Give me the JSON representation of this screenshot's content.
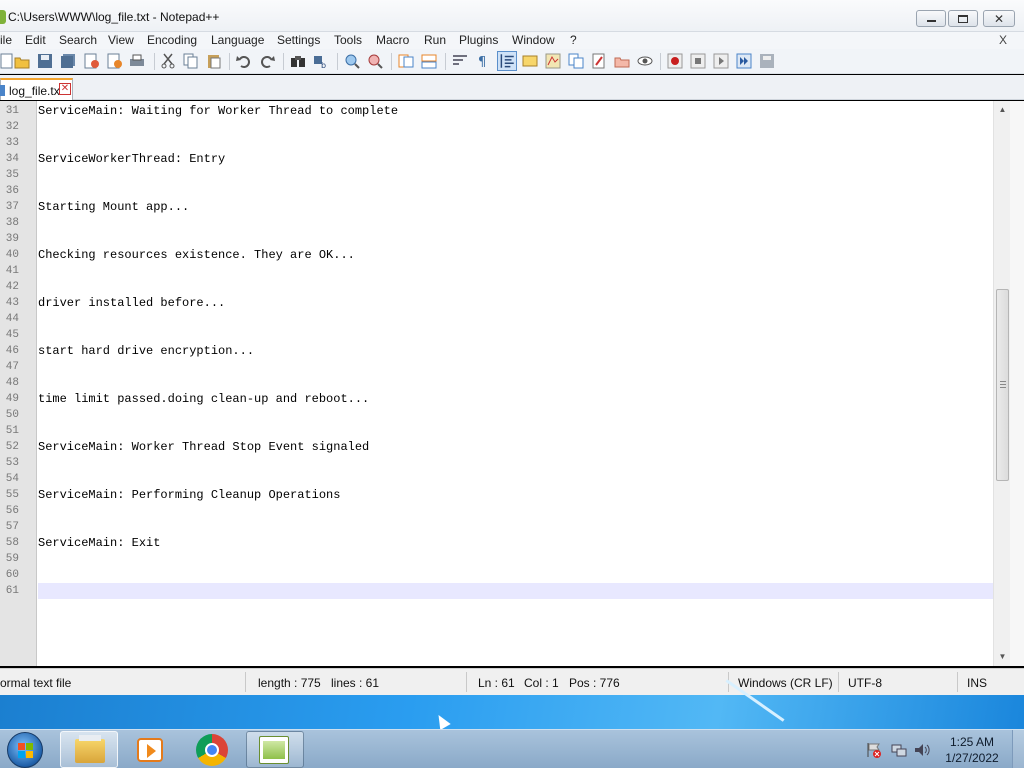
{
  "window": {
    "title": "C:\\Users\\WWW\\log_file.txt - Notepad++"
  },
  "menu": {
    "items": [
      "ile",
      "Edit",
      "Search",
      "View",
      "Encoding",
      "Language",
      "Settings",
      "Tools",
      "Macro",
      "Run",
      "Plugins",
      "Window",
      "?"
    ],
    "close_label": "X"
  },
  "toolbar": {
    "icons": [
      "new-file-icon",
      "open-file-icon",
      "save-icon",
      "save-all-icon",
      "close-icon",
      "close-all-icon",
      "print-icon",
      "cut-icon",
      "copy-icon",
      "paste-icon",
      "undo-icon",
      "redo-icon",
      "find-icon",
      "replace-icon",
      "zoom-in-icon",
      "zoom-out-icon",
      "sync-vertical-icon",
      "sync-horizontal-icon",
      "word-wrap-icon",
      "show-all-characters-icon",
      "indent-guide-icon",
      "user-language-icon",
      "document-map-icon",
      "function-list-icon",
      "folder-as-workspace-icon",
      "monitoring-icon",
      "record-macro-icon",
      "stop-recording-icon",
      "playback-macro-icon",
      "run-macro-multiple-icon",
      "save-macro-icon"
    ],
    "active_icon": "indent-guide-icon"
  },
  "tab": {
    "label": "log_file.txt",
    "close_glyph": "✕"
  },
  "editor": {
    "first_line_number": 31,
    "lines": [
      "ServiceMain: Waiting for Worker Thread to complete",
      "",
      "",
      "ServiceWorkerThread: Entry",
      "",
      "",
      "Starting Mount app...",
      "",
      "",
      "Checking resources existence. They are OK...",
      "",
      "",
      "driver installed before...",
      "",
      "",
      "start hard drive encryption...",
      "",
      "",
      "time limit passed.doing clean-up and reboot...",
      "",
      "",
      "ServiceMain: Worker Thread Stop Event signaled",
      "",
      "",
      "ServiceMain: Performing Cleanup Operations",
      "",
      "",
      "ServiceMain: Exit",
      "",
      "",
      ""
    ],
    "current_line": 61,
    "scroll_up_glyph": "▲",
    "scroll_down_glyph": "▼"
  },
  "status": {
    "file_type": "ormal text file",
    "length": "length : 775",
    "lines": "lines : 61",
    "ln": "Ln : 61",
    "col": "Col : 1",
    "pos": "Pos : 776",
    "eol": "Windows (CR LF)",
    "encoding": "UTF-8",
    "mode": "INS"
  },
  "taskbar": {
    "pinned": [
      "windows-explorer-icon",
      "media-player-icon",
      "chrome-icon",
      "notepad-plus-plus-icon"
    ],
    "tray_icons": [
      "action-center-flag-icon",
      "network-icon",
      "volume-icon"
    ],
    "time": "1:25 AM",
    "date": "1/27/2022"
  },
  "colors": {
    "tab_accent": "#f3a32b",
    "current_line_bg": "#e8e8ff",
    "gutter_bg": "#e4e4e4",
    "taskbar_bg": "#9ab6d3"
  }
}
